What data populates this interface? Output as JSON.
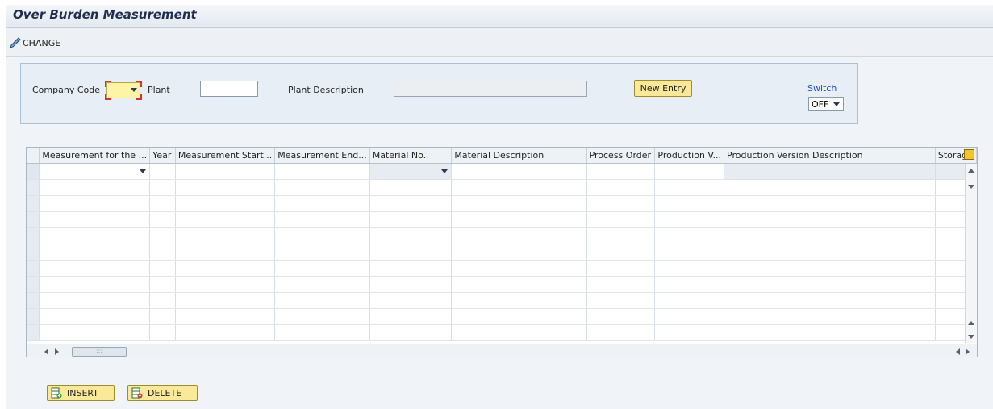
{
  "window": {
    "title": "Over Burden Measurement"
  },
  "toolbar": {
    "change_label": "CHANGE"
  },
  "header": {
    "company_code_label": "Company Code",
    "company_code_value": "",
    "plant_label": "Plant",
    "plant_value": "",
    "plant_description_label": "Plant Description",
    "plant_description_value": "",
    "new_entry_label": "New Entry",
    "switch_label": "Switch",
    "switch_value": "OFF"
  },
  "table": {
    "columns": [
      "Measurement for the ...",
      "Year",
      "Measurement Start...",
      "Measurement End...",
      "Material No.",
      "Material Description",
      "Process Order",
      "Production V...",
      "Production Version Description",
      "Storag"
    ],
    "row_count": 11
  },
  "scroll": {
    "h_thumb": ":::"
  },
  "footer": {
    "insert_label": "INSERT",
    "delete_label": "DELETE"
  },
  "colors": {
    "accent_yellow": "#fbe99a",
    "switch_blue": "#1a4fcf",
    "required_red": "#d23232"
  }
}
